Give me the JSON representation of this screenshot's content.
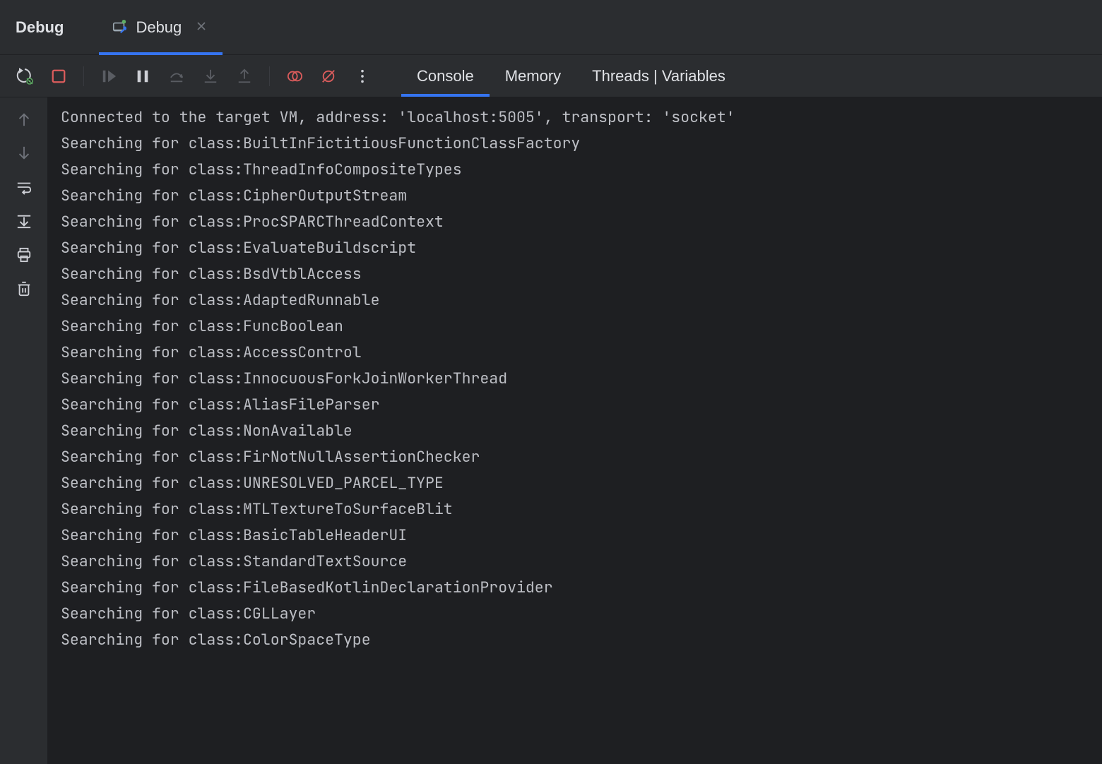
{
  "panel": {
    "title": "Debug"
  },
  "tab": {
    "label": "Debug"
  },
  "views": {
    "console": "Console",
    "memory": "Memory",
    "threads": "Threads | Variables"
  },
  "console_lines": [
    "Connected to the target VM, address: 'localhost:5005', transport: 'socket'",
    "Searching for class:BuiltInFictitiousFunctionClassFactory",
    "Searching for class:ThreadInfoCompositeTypes",
    "Searching for class:CipherOutputStream",
    "Searching for class:ProcSPARCThreadContext",
    "Searching for class:EvaluateBuildscript",
    "Searching for class:BsdVtblAccess",
    "Searching for class:AdaptedRunnable",
    "Searching for class:FuncBoolean",
    "Searching for class:AccessControl",
    "Searching for class:InnocuousForkJoinWorkerThread",
    "Searching for class:AliasFileParser",
    "Searching for class:NonAvailable",
    "Searching for class:FirNotNullAssertionChecker",
    "Searching for class:UNRESOLVED_PARCEL_TYPE",
    "Searching for class:MTLTextureToSurfaceBlit",
    "Searching for class:BasicTableHeaderUI",
    "Searching for class:StandardTextSource",
    "Searching for class:FileBasedKotlinDeclarationProvider",
    "Searching for class:CGLLayer",
    "Searching for class:ColorSpaceType"
  ]
}
